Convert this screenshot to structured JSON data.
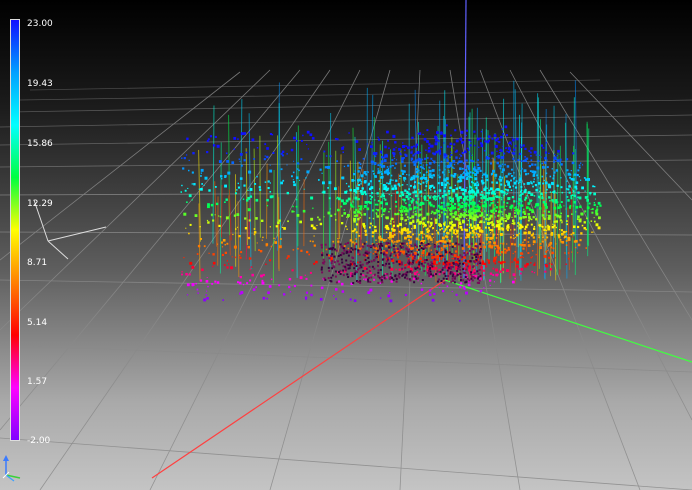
{
  "scalar_bar": {
    "labels": [
      "23.00",
      "19.43",
      "15.86",
      "12.29",
      "8.71",
      "5.14",
      "1.57",
      "-2.00"
    ],
    "min": -2.0,
    "max": 23.0,
    "colormap": [
      "#1010ff",
      "#00a0ff",
      "#00ffff",
      "#00ff40",
      "#ffff00",
      "#ff8000",
      "#ff0000",
      "#ff00ff",
      "#8000ff"
    ]
  },
  "axes": {
    "x_color": "#ff4040",
    "y_color": "#40ff40",
    "z_color": "#6060ff"
  },
  "orientation_widget": {
    "icon": "xyz-axes-icon"
  }
}
